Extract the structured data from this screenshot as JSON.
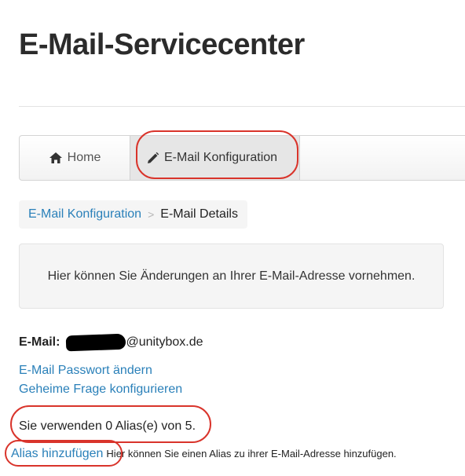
{
  "page": {
    "title": "E-Mail-Servicecenter"
  },
  "nav": {
    "home_label": "Home",
    "config_label": "E-Mail Konfiguration",
    "home_icon": "home-icon",
    "config_icon": "pencil-icon"
  },
  "breadcrumb": {
    "parent": "E-Mail Konfiguration",
    "separator": ">",
    "current": "E-Mail Details"
  },
  "info": {
    "text": "Hier können Sie Änderungen an Ihrer E-Mail-Adresse vornehmen."
  },
  "email": {
    "label": "E-Mail:",
    "domain": "@unitybox.de"
  },
  "links": {
    "change_password": "E-Mail Passwort ändern",
    "secret_question": "Geheime Frage konfigurieren"
  },
  "alias": {
    "usage_text": "Sie verwenden 0 Alias(e) von 5.",
    "add_link": "Alias hinzufügen",
    "help_text": "Hier können Sie einen Alias zu ihrer E-Mail-Adresse hinzufügen."
  },
  "colors": {
    "link": "#2a80b9",
    "annotation": "#d9342b"
  }
}
